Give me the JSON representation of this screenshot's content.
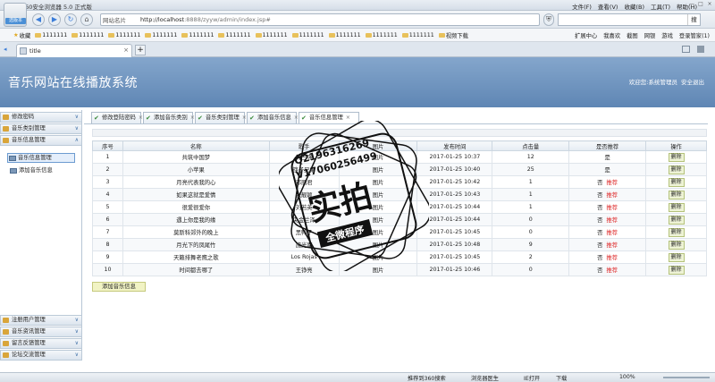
{
  "browser": {
    "title": "360安全浏览器 5.0 正式版",
    "logo_label": "选版本",
    "menu": [
      "文件(F)",
      "查看(V)",
      "收藏(B)",
      "工具(T)",
      "帮助(H)"
    ],
    "window_buttons": [
      "—",
      "□",
      "×"
    ],
    "fav_label": "网站名片",
    "url_host": "http://localhost",
    "url_rest": ":8888/zyyw/admin/index.jsp#",
    "search_button": "搜",
    "bookmarks": [
      "收藏",
      "1111111",
      "1111111",
      "1111111",
      "1111111",
      "1111111",
      "1111111",
      "1111111",
      "1111111",
      "1111111",
      "1111111",
      "1111111",
      "视频下载"
    ],
    "bookmark_right": [
      "扩展中心",
      "我喜欢",
      "截图",
      "网银",
      "游戏",
      "登录管家(1)"
    ],
    "tab_title": "title",
    "tab_close": "×",
    "new_tab": "+"
  },
  "app": {
    "title": "音乐网站在线播放系统",
    "welcome": "欢迎您:系统管理员",
    "logout": "安全退出"
  },
  "sidebar": {
    "top_sections": [
      "修改密码",
      "音乐类别管理",
      "音乐信息管理"
    ],
    "items": [
      "音乐信息管理",
      "添加音乐信息"
    ],
    "bottom_sections": [
      "注册用户管理",
      "音乐资讯管理",
      "留言反馈管理",
      "论坛交流管理"
    ]
  },
  "content_tabs": [
    "修改登陆密码",
    "添加音乐类别",
    "音乐类别管理",
    "添加音乐信息",
    "音乐信息管理"
  ],
  "table": {
    "headers": [
      "序号",
      "名称",
      "歌手",
      "图片",
      "发布时间",
      "点击量",
      "是否推荐",
      "操作"
    ],
    "rows": [
      [
        "1",
        "共筑中国梦",
        "韩三强",
        "图片",
        "2017-01-25 10:37",
        "12",
        "是",
        "",
        "删除"
      ],
      [
        "2",
        "小苹果",
        "筷子兄弟",
        "图片",
        "2017-01-25 10:40",
        "25",
        "是",
        "",
        "删除"
      ],
      [
        "3",
        "月亮代表我的心",
        "邓丽君",
        "图片",
        "2017-01-25 10:42",
        "1",
        "否",
        "推荐",
        "删除"
      ],
      [
        "4",
        "如果这就是爱情",
        "张靓颖",
        "图片",
        "2017-01-25 10:43",
        "1",
        "否",
        "推荐",
        "删除"
      ],
      [
        "5",
        "很爱很爱你",
        "刘若英",
        "图片",
        "2017-01-25 10:44",
        "1",
        "否",
        "推荐",
        "删除"
      ],
      [
        "6",
        "遇上你是我的缘",
        "央金兰泽",
        "图片",
        "2017-01-25 10:44",
        "0",
        "否",
        "推荐",
        "删除"
      ],
      [
        "7",
        "莫斯科郊外的晚上",
        "黑鸭子",
        "图片",
        "2017-01-25 10:45",
        "0",
        "否",
        "推荐",
        "删除"
      ],
      [
        "8",
        "月光下的凤尾竹",
        "施光南",
        "图片",
        "2017-01-25 10:48",
        "9",
        "否",
        "推荐",
        "删除"
      ],
      [
        "9",
        "天籁排舞老鹰之歌",
        "Los Rojas",
        "图片",
        "2017-01-25 10:45",
        "2",
        "否",
        "推荐",
        "删除"
      ],
      [
        "10",
        "时间都去哪了",
        "王铮亮",
        "图片",
        "2017-01-25 10:46",
        "0",
        "否",
        "推荐",
        "删除"
      ]
    ]
  },
  "add_button": "添加音乐信息",
  "statusbar": {
    "items": [
      "推荐到360搜索",
      "浏览器医生",
      "IE打开",
      "下载",
      "100%"
    ]
  },
  "watermark": {
    "phone1": "Q2196316269",
    "phone2": "V17060256499",
    "big": "实拍",
    "band": "全微程序"
  }
}
